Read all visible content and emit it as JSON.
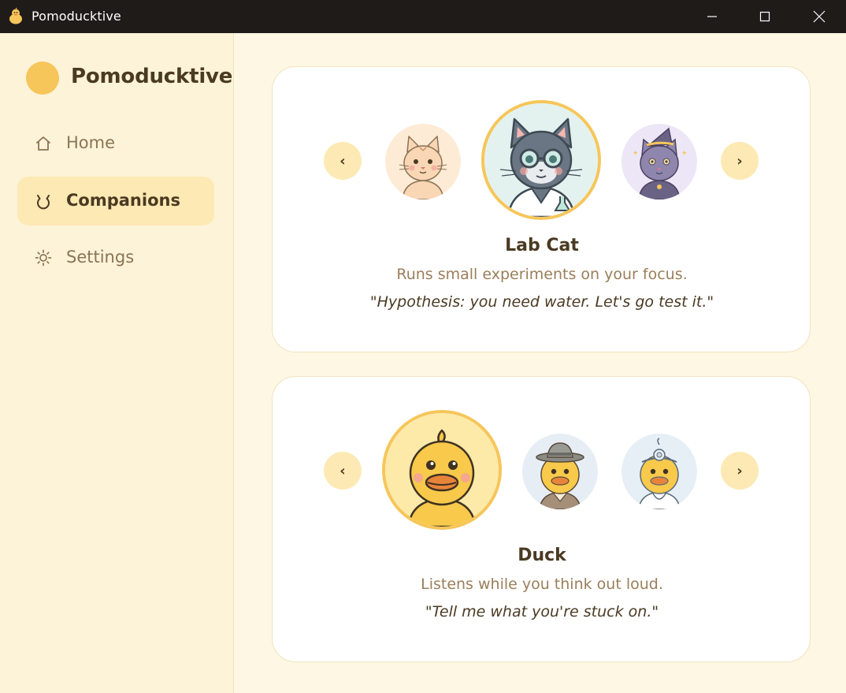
{
  "window": {
    "title": "Pomoducktive",
    "app_icon": "duck-icon",
    "controls": [
      "minimize-icon",
      "maximize-icon",
      "close-icon"
    ]
  },
  "sidebar": {
    "brand": "Pomoducktive",
    "items": [
      {
        "label": "Home",
        "icon": "home-icon",
        "active": false
      },
      {
        "label": "Companions",
        "icon": "cat-face-icon",
        "active": true
      },
      {
        "label": "Settings",
        "icon": "gear-icon",
        "active": false
      }
    ]
  },
  "carousels": [
    {
      "prev": "‹",
      "next": "›",
      "avatars": [
        "peach-cat",
        "lab-cat",
        "witch-cat"
      ],
      "selected": "lab-cat",
      "name": "Lab Cat",
      "description": "Runs small experiments on your focus.",
      "quote": "\"Hypothesis: you need water. Let's go test it.\""
    },
    {
      "prev": "‹",
      "next": "›",
      "avatars": [
        "duck",
        "detective-duck",
        "doctor-duck"
      ],
      "selected": "duck",
      "name": "Duck",
      "description": "Listens while you think out loud.",
      "quote": "\"Tell me what you're stuck on.\""
    }
  ],
  "colors": {
    "accent": "#f6c65a",
    "accent_soft": "#fde9b3",
    "background": "#fef7e3",
    "text": "#4a3a22",
    "muted": "#9a7f5a"
  }
}
